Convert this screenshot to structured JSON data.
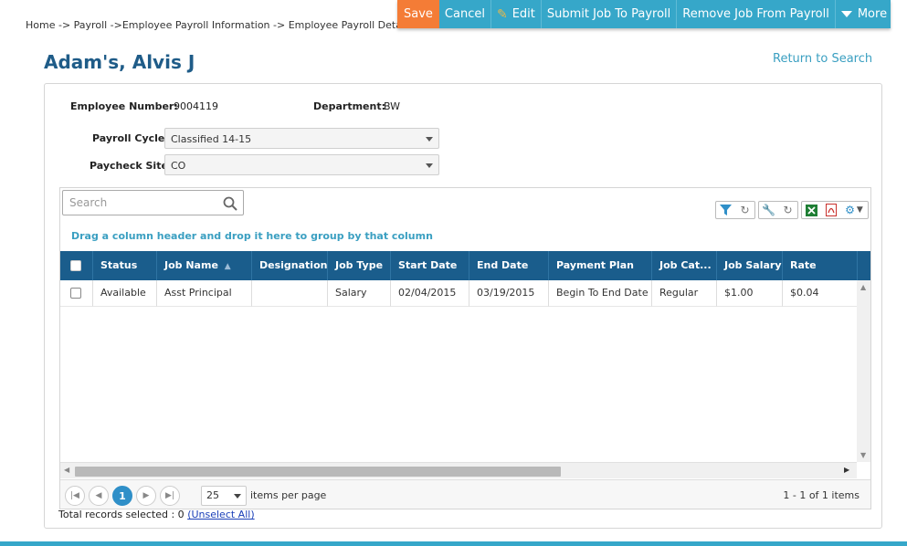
{
  "breadcrumb": "Home -> Payroll ->Employee Payroll Information -> Employee Payroll Detail",
  "toolbar": {
    "save": "Save",
    "cancel": "Cancel",
    "edit": "Edit",
    "submit": "Submit Job To Payroll",
    "remove": "Remove Job From Payroll",
    "more": "More",
    "save_color": "#f47c36",
    "bar_color": "#36a7c9"
  },
  "page_title": "Adam's, Alvis J",
  "return_link": "Return to Search",
  "employee": {
    "number_label": "Employee Number:",
    "number": "9004119",
    "department_label": "Department:",
    "department": "BW"
  },
  "payroll_cycle": {
    "label": "Payroll Cycle:",
    "value": "Classified 14-15"
  },
  "paycheck_site": {
    "label": "Paycheck Site:",
    "value": "CO"
  },
  "grid": {
    "search_placeholder": "Search",
    "group_hint": "Drag a column header and drop it here to group by that column",
    "tools": [
      "filter-icon",
      "refresh-icon",
      "wrench-icon",
      "reset-icon",
      "excel-icon",
      "pdf-icon",
      "settings-icon"
    ],
    "columns": [
      "Status",
      "Job Name",
      "Designation",
      "Job Type",
      "Start Date",
      "End Date",
      "Payment Plan",
      "Job Cat...",
      "Job Salary",
      "Rate"
    ],
    "sorted_column": "Job Name",
    "rows": [
      {
        "status": "Available",
        "job_name": "Asst Principal",
        "designation": "",
        "job_type": "Salary",
        "start_date": "02/04/2015",
        "end_date": "03/19/2015",
        "payment_plan": "Begin To End Date",
        "job_category": "Regular",
        "job_salary": "$1.00",
        "rate": "$0.04"
      }
    ],
    "header_color": "#1a5d8c",
    "pager": {
      "current_page": "1",
      "page_size": "25",
      "items_per_page": "items per page",
      "summary": "1 - 1 of 1 items"
    }
  },
  "selection": {
    "text": "Total records selected : 0",
    "unselect_link": "(Unselect All)"
  }
}
